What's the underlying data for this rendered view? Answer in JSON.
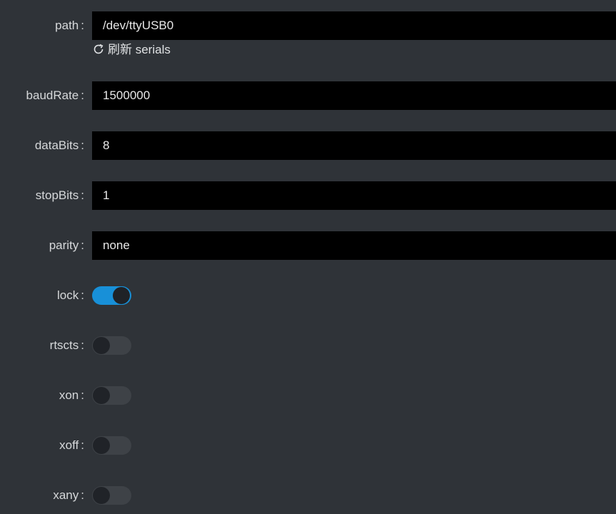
{
  "colon": ":",
  "path": {
    "label": "path",
    "value": "/dev/ttyUSB0",
    "refresh_label": "刷新 serials",
    "refresh_icon": "refresh-icon"
  },
  "baudRate": {
    "label": "baudRate",
    "value": "1500000"
  },
  "dataBits": {
    "label": "dataBits",
    "value": "8"
  },
  "stopBits": {
    "label": "stopBits",
    "value": "1"
  },
  "parity": {
    "label": "parity",
    "value": "none"
  },
  "lock": {
    "label": "lock",
    "checked": true
  },
  "rtscts": {
    "label": "rtscts",
    "checked": false
  },
  "xon": {
    "label": "xon",
    "checked": false
  },
  "xoff": {
    "label": "xoff",
    "checked": false
  },
  "xany": {
    "label": "xany",
    "checked": false
  },
  "colors": {
    "background": "#2f3338",
    "field": "#000000",
    "switch_on": "#1890d8",
    "switch_off": "#3e4247"
  }
}
